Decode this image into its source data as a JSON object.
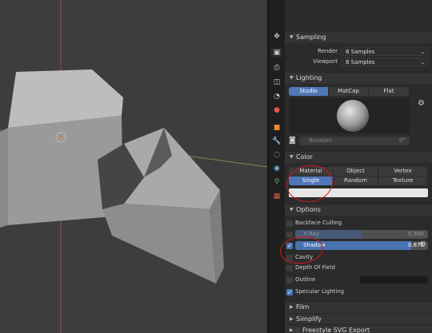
{
  "window": {
    "editor_type_icon": "properties-editor-icon",
    "search_placeholder": ""
  },
  "sidebar_tabs": [
    "tool-tab-icon",
    "render-tab-icon",
    "output-tab-icon",
    "view-layer-tab-icon",
    "scene-tab-icon",
    "world-tab-icon",
    "object-tab-icon",
    "modifier-tab-icon",
    "particles-tab-icon",
    "physics-tab-icon",
    "constraints-tab-icon",
    "data-tab-icon",
    "material-tab-icon",
    "texture-tab-icon"
  ],
  "sampling": {
    "title": "Sampling",
    "render_label": "Render",
    "render_value": "8 Samples",
    "viewport_label": "Viewport",
    "viewport_value": "8 Samples"
  },
  "lighting": {
    "title": "Lighting",
    "modes": [
      "Studio",
      "MatCap",
      "Flat"
    ],
    "active_mode": "Studio",
    "rotation_label": "Rotation",
    "rotation_value": "0°"
  },
  "color": {
    "title": "Color",
    "row1": [
      "Material",
      "Object",
      "Vertex"
    ],
    "row2": [
      "Single",
      "Random",
      "Texture"
    ],
    "active": "Single",
    "single_color": "#e6e6e6"
  },
  "options": {
    "title": "Options",
    "backface_culling": "Backface Culling",
    "xray_label": "X-Ray",
    "xray_value": "0.500",
    "shadow_label": "Shadow",
    "shadow_value": "0.875",
    "shadow_fraction": 0.875,
    "cavity": "Cavity",
    "depth_of_field": "Depth Of Field",
    "outline": "Outline",
    "outline_color": "#1c1c1c",
    "specular_lighting": "Specular Lighting"
  },
  "collapsed_panels": [
    "Film",
    "Simplify",
    "Freestyle SVG Export"
  ],
  "colors": {
    "accent": "#4f77b8",
    "annotation": "#d21a1a",
    "viewport_bg": "#3d3d3d"
  }
}
